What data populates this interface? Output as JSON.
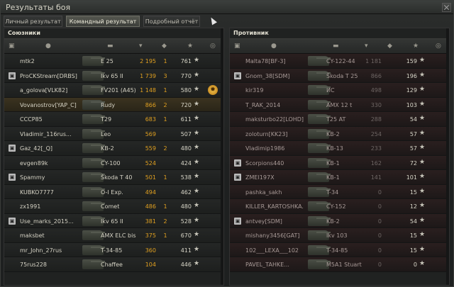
{
  "window": {
    "title": "Результаты боя"
  },
  "tabs": [
    {
      "label": "Личный результат",
      "active": false
    },
    {
      "label": "Командный результат",
      "active": true
    },
    {
      "label": "Подробный отчёт",
      "active": false
    }
  ],
  "allies": {
    "title": "Союзники",
    "rows": [
      {
        "squad": false,
        "player": "mtk2",
        "tank": "E 25",
        "damage": "2 195",
        "kills": "1",
        "xp": "761",
        "highlight": false
      },
      {
        "squad": true,
        "player": "ProCKStream[DRBS]",
        "tank": "Ikv 65 II",
        "damage": "1 739",
        "kills": "3",
        "xp": "770",
        "highlight": false
      },
      {
        "squad": false,
        "player": "a_golova[VLK82]",
        "tank": "FV201 (A45)",
        "damage": "1 148",
        "kills": "1",
        "xp": "580",
        "highlight": false,
        "medal": true
      },
      {
        "squad": false,
        "player": "Vovanostrov[YAP_C]",
        "tank": "Rudy",
        "damage": "866",
        "kills": "2",
        "xp": "720",
        "highlight": true
      },
      {
        "squad": false,
        "player": "CCCP85",
        "tank": "T29",
        "damage": "683",
        "kills": "1",
        "xp": "611",
        "highlight": false
      },
      {
        "squad": false,
        "player": "Vladimir_116rus...",
        "tank": "Leo",
        "damage": "569",
        "kills": "",
        "xp": "507",
        "highlight": false
      },
      {
        "squad": true,
        "player": "Gaz_42[_Q]",
        "tank": "KB-2",
        "damage": "559",
        "kills": "2",
        "xp": "480",
        "highlight": false
      },
      {
        "squad": false,
        "player": "evgen89k",
        "tank": "CY-100",
        "damage": "524",
        "kills": "",
        "xp": "424",
        "highlight": false
      },
      {
        "squad": true,
        "player": "Spammy",
        "tank": "Škoda T 40",
        "damage": "501",
        "kills": "1",
        "xp": "538",
        "highlight": false
      },
      {
        "squad": false,
        "player": "KUBKO7777",
        "tank": "O-I Exp.",
        "damage": "494",
        "kills": "",
        "xp": "462",
        "highlight": false
      },
      {
        "squad": false,
        "player": "zx1991",
        "tank": "Comet",
        "damage": "486",
        "kills": "1",
        "xp": "480",
        "highlight": false
      },
      {
        "squad": true,
        "player": "Use_marks_2015...",
        "tank": "Ikv 65 II",
        "damage": "381",
        "kills": "2",
        "xp": "528",
        "highlight": false
      },
      {
        "squad": false,
        "player": "maksbet",
        "tank": "AMX ELC bis",
        "damage": "375",
        "kills": "1",
        "xp": "670",
        "highlight": false
      },
      {
        "squad": false,
        "player": "mr_John_27rus",
        "tank": "T-34-85",
        "damage": "360",
        "kills": "",
        "xp": "411",
        "highlight": false
      },
      {
        "squad": false,
        "player": "75rus228",
        "tank": "Chaffee",
        "damage": "104",
        "kills": "",
        "xp": "446",
        "highlight": false
      }
    ]
  },
  "enemies": {
    "title": "Противник",
    "rows": [
      {
        "squad": false,
        "player": "Malta78[BF-3]",
        "tank": "CY-122-44",
        "damage": "1 181",
        "kills": "",
        "xp": "159"
      },
      {
        "squad": true,
        "player": "Gnom_38[SDM]",
        "tank": "Škoda T 25",
        "damage": "866",
        "kills": "",
        "xp": "196"
      },
      {
        "squad": false,
        "player": "kir319",
        "tank": "ИС",
        "damage": "498",
        "kills": "",
        "xp": "129"
      },
      {
        "squad": false,
        "player": "T_RAK_2014",
        "tank": "AMX 12 t",
        "damage": "330",
        "kills": "",
        "xp": "103"
      },
      {
        "squad": false,
        "player": "maksturbo22[LOHD]",
        "tank": "T25 AT",
        "damage": "288",
        "kills": "",
        "xp": "54"
      },
      {
        "squad": false,
        "player": "zoloturn[KK23]",
        "tank": "KB-2",
        "damage": "254",
        "kills": "",
        "xp": "57"
      },
      {
        "squad": false,
        "player": "Vladimip1986",
        "tank": "KB-13",
        "damage": "233",
        "kills": "",
        "xp": "57"
      },
      {
        "squad": true,
        "player": "Scorpions440",
        "tank": "KB-1",
        "damage": "162",
        "kills": "",
        "xp": "72"
      },
      {
        "squad": true,
        "player": "ZMEI197X",
        "tank": "KB-1",
        "damage": "141",
        "kills": "",
        "xp": "101"
      },
      {
        "squad": false,
        "player": "pashka_sakh",
        "tank": "T-34",
        "damage": "0",
        "kills": "",
        "xp": "15"
      },
      {
        "squad": false,
        "player": "KILLER_KARTOSHKA...",
        "tank": "CY-152",
        "damage": "0",
        "kills": "",
        "xp": "12"
      },
      {
        "squad": true,
        "player": "antvey[SDM]",
        "tank": "KB-2",
        "damage": "0",
        "kills": "",
        "xp": "54"
      },
      {
        "squad": false,
        "player": "mishany3456[GAT]",
        "tank": "Ikv 103",
        "damage": "0",
        "kills": "",
        "xp": "15"
      },
      {
        "squad": false,
        "player": "102___LEXA___102",
        "tank": "T-34-85",
        "damage": "0",
        "kills": "",
        "xp": "15"
      },
      {
        "squad": false,
        "player": "PAVEL_TAHKE...",
        "tank": "M5A1 Stuart",
        "damage": "0",
        "kills": "",
        "xp": "0"
      }
    ]
  },
  "icons": {
    "squad": "squad-badge-icon",
    "player": "player-icon",
    "tank": "tank-icon",
    "damage": "damage-icon",
    "kills": "kills-icon",
    "xp": "star-icon",
    "medal": "medal-icon"
  }
}
